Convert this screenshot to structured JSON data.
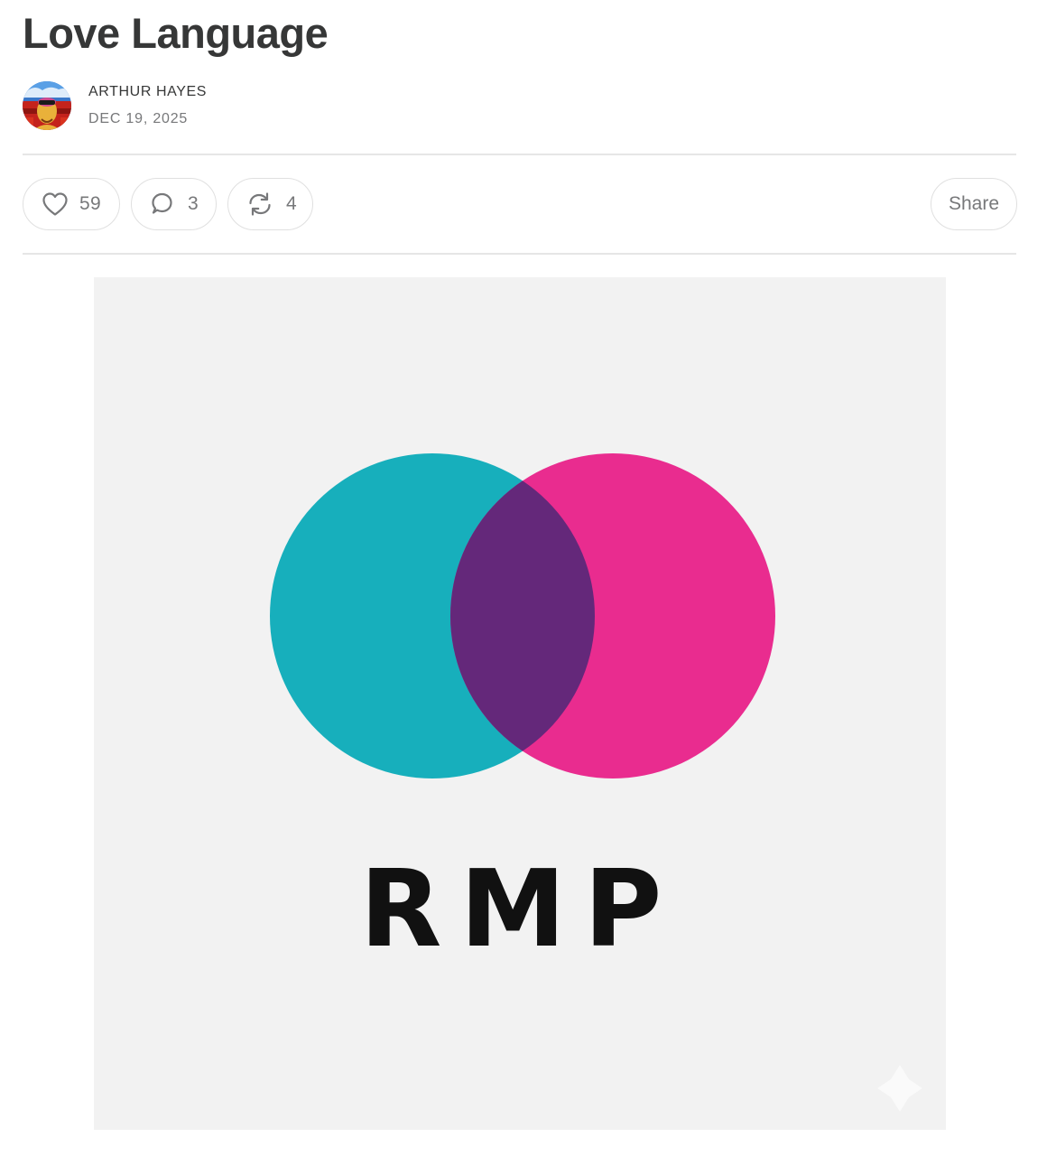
{
  "post": {
    "title": "Love Language",
    "author": "ARTHUR HAYES",
    "date": "DEC 19, 2025"
  },
  "actions": {
    "like_count": "59",
    "comment_count": "3",
    "restack_count": "4",
    "share_label": "Share",
    "icons": [
      "heart-icon",
      "comment-icon",
      "restack-icon"
    ]
  },
  "image": {
    "logo_text": "RMP",
    "colors": {
      "background": "#f2f2f2",
      "teal": "#17afbc",
      "magenta": "#e92c8f",
      "overlap": "#64287a",
      "text": "#111111"
    }
  }
}
